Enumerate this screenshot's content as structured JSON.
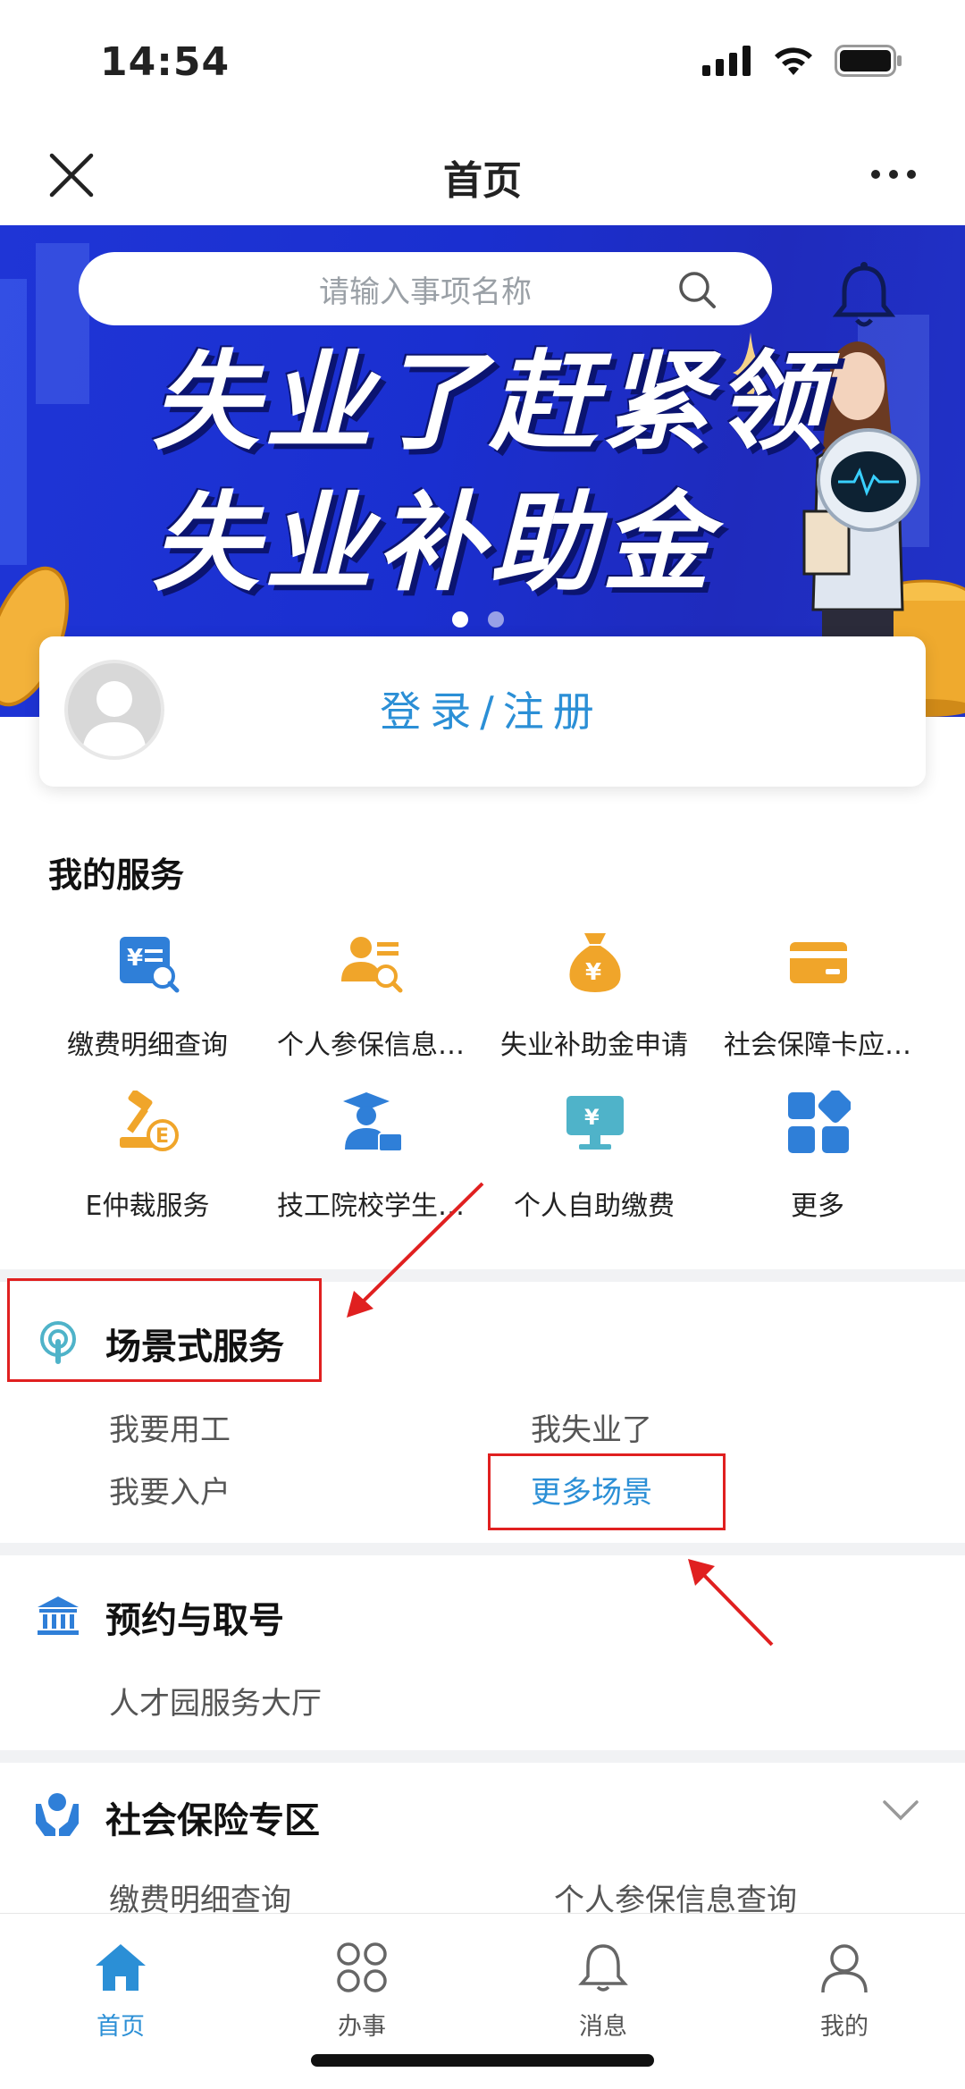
{
  "status_bar": {
    "time": "14:54"
  },
  "nav": {
    "title": "首页"
  },
  "banner": {
    "search_placeholder": "请输入事项名称",
    "headline_line1": "失业了赶紧领",
    "headline_line2": "失业补助金",
    "dot_count": 2,
    "active_dot": 1
  },
  "login": {
    "label": "登录/注册"
  },
  "my_services": {
    "title": "我的服务",
    "items": [
      {
        "label": "缴费明细查询",
        "icon": "payment-detail-icon",
        "color": "#2f7fd8"
      },
      {
        "label": "个人参保信息…",
        "icon": "personal-insurance-icon",
        "color": "#f0a52a"
      },
      {
        "label": "失业补助金申请",
        "icon": "money-bag-icon",
        "color": "#f0a52a"
      },
      {
        "label": "社会保障卡应…",
        "icon": "card-icon",
        "color": "#f0a52a"
      },
      {
        "label": "E仲裁服务",
        "icon": "gavel-icon",
        "color": "#f0a52a"
      },
      {
        "label": "技工院校学生…",
        "icon": "student-icon",
        "color": "#2f7fd8"
      },
      {
        "label": "个人自助缴费",
        "icon": "self-pay-icon",
        "color": "#4fb3c9"
      },
      {
        "label": "更多",
        "icon": "more-grid-icon",
        "color": "#2f7fd8"
      }
    ]
  },
  "scene_services": {
    "title": "场景式服务",
    "links": [
      {
        "label": "我要用工"
      },
      {
        "label": "我失业了"
      },
      {
        "label": "我要入户"
      },
      {
        "label": "更多场景"
      }
    ]
  },
  "appointment": {
    "title": "预约与取号",
    "item": "人才园服务大厅"
  },
  "social_insurance": {
    "title": "社会保险专区",
    "items": [
      "缴费明细查询",
      "个人参保信息查询"
    ]
  },
  "tab_bar": {
    "tabs": [
      {
        "label": "首页",
        "active": true
      },
      {
        "label": "办事",
        "active": false
      },
      {
        "label": "消息",
        "active": false
      },
      {
        "label": "我的",
        "active": false
      }
    ]
  },
  "colors": {
    "accent": "#2b8fd6",
    "annotation": "#e02020",
    "banner": "#1f35d6"
  }
}
